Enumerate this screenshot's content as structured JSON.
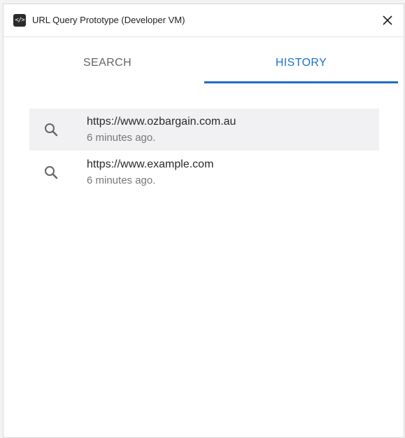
{
  "window": {
    "title": "URL Query Prototype (Developer VM)",
    "app_icon_glyph": "</>"
  },
  "tabs": [
    {
      "label": "SEARCH",
      "active": false
    },
    {
      "label": "HISTORY",
      "active": true
    }
  ],
  "history": {
    "items": [
      {
        "url": "https://www.ozbargain.com.au",
        "time": "6 minutes ago.",
        "selected": true,
        "icon": "search-icon"
      },
      {
        "url": "https://www.example.com",
        "time": "6 minutes ago.",
        "selected": false,
        "icon": "search-icon"
      }
    ]
  },
  "colors": {
    "accent": "#1f6fc1",
    "selected_row_bg": "#f1f1f3"
  }
}
